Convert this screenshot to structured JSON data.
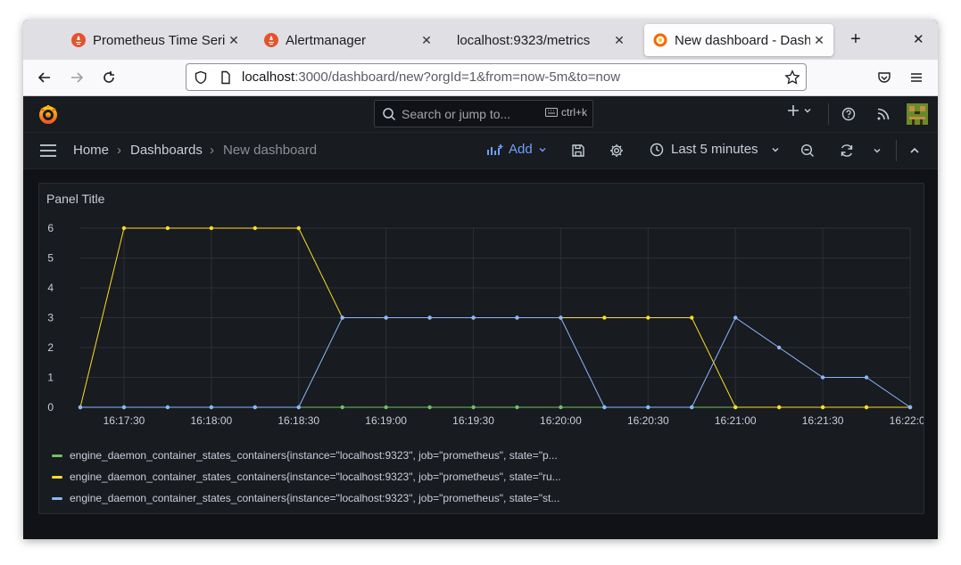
{
  "browser": {
    "tabs": [
      {
        "label": "Prometheus Time Series",
        "active": false
      },
      {
        "label": "Alertmanager",
        "active": false
      },
      {
        "label": "localhost:9323/metrics",
        "active": false
      },
      {
        "label": "New dashboard - Dashboards",
        "active": true
      }
    ],
    "url_host": "localhost",
    "url_rest": ":3000/dashboard/new?orgId=1&from=now-5m&to=now"
  },
  "grafana": {
    "search_placeholder": "Search or jump to...",
    "search_shortcut": "ctrl+k",
    "breadcrumb": [
      "Home",
      "Dashboards",
      "New dashboard"
    ],
    "add_label": "Add",
    "time_range": "Last 5 minutes"
  },
  "panel": {
    "title": "Panel Title"
  },
  "colors": {
    "green": "#73bf69",
    "yellow": "#fade2a",
    "blue": "#8ab8ff"
  },
  "chart_data": {
    "type": "line",
    "x": [
      "16:17:15",
      "16:17:30",
      "16:17:45",
      "16:18:00",
      "16:18:15",
      "16:18:30",
      "16:18:45",
      "16:19:00",
      "16:19:15",
      "16:19:30",
      "16:19:45",
      "16:20:00",
      "16:20:15",
      "16:20:30",
      "16:20:45",
      "16:21:00",
      "16:21:15",
      "16:21:30",
      "16:21:45",
      "16:22:00"
    ],
    "x_ticks": [
      "16:17:30",
      "16:18:00",
      "16:18:30",
      "16:19:00",
      "16:19:30",
      "16:20:00",
      "16:20:30",
      "16:21:00",
      "16:21:30",
      "16:22:00"
    ],
    "y_ticks": [
      "0",
      "1",
      "2",
      "3",
      "4",
      "5",
      "6"
    ],
    "ylim": [
      0,
      6
    ],
    "series": [
      {
        "name": "engine_daemon_container_states_containers{instance=\"localhost:9323\", job=\"prometheus\", state=\"p...",
        "color": "green",
        "values": [
          0,
          0,
          0,
          0,
          0,
          0,
          0,
          0,
          0,
          0,
          0,
          0,
          0,
          0,
          0,
          0,
          0,
          0,
          0,
          0
        ]
      },
      {
        "name": "engine_daemon_container_states_containers{instance=\"localhost:9323\", job=\"prometheus\", state=\"ru...",
        "color": "yellow",
        "values": [
          0,
          6,
          6,
          6,
          6,
          6,
          3,
          3,
          3,
          3,
          3,
          3,
          3,
          3,
          3,
          0,
          0,
          0,
          0,
          0
        ]
      },
      {
        "name": "engine_daemon_container_states_containers{instance=\"localhost:9323\", job=\"prometheus\", state=\"st...",
        "color": "blue",
        "values": [
          0,
          0,
          0,
          0,
          0,
          0,
          3,
          3,
          3,
          3,
          3,
          3,
          0,
          0,
          0,
          3,
          2,
          1,
          1,
          0
        ]
      }
    ],
    "grid": true,
    "legend_position": "bottom"
  }
}
